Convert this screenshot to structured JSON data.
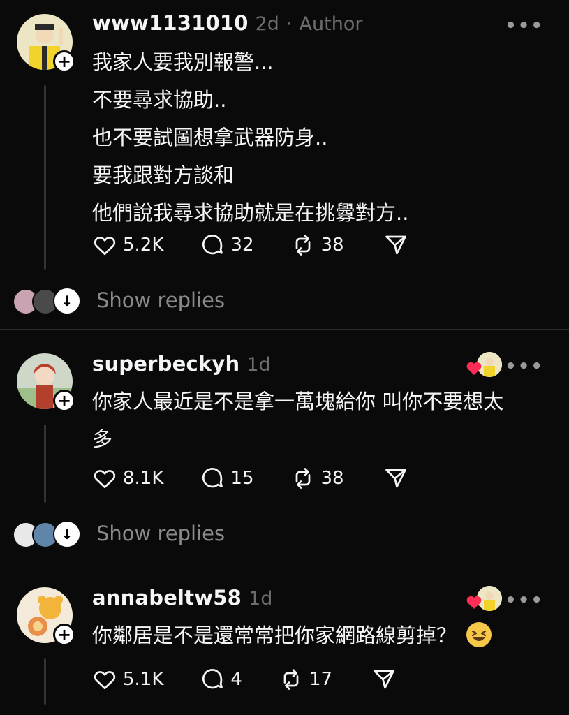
{
  "posts": [
    {
      "username": "www1131010",
      "time": "2d",
      "separator": "·",
      "author_tag": "Author",
      "more": "•••",
      "lines": [
        "我家人要我別報警...",
        "不要尋求協助..",
        "也不要試圖想拿武器防身..",
        "要我跟對方談和",
        "他們說我尋求協助就是在挑釁對方.."
      ],
      "likes": "5.2K",
      "replies": "32",
      "reposts": "38",
      "show_replies": "Show replies"
    },
    {
      "username": "superbeckyh",
      "time": "1d",
      "more": "•••",
      "lines": [
        "你家人最近是不是拿一萬塊給你 叫你不要想太",
        "多"
      ],
      "likes": "8.1K",
      "replies": "15",
      "reposts": "38",
      "show_replies": "Show replies"
    },
    {
      "username": "annabeltw58",
      "time": "1d",
      "more": "•••",
      "lines": [
        "你鄰居是不是還常常把你家網路線剪掉？"
      ],
      "likes": "5.1K",
      "replies": "4",
      "reposts": "17"
    }
  ],
  "icons": {
    "follow": "plus-icon",
    "like": "heart-icon",
    "reply": "comment-icon",
    "repost": "repost-icon",
    "share": "send-icon",
    "expand": "arrow-down-icon",
    "emoji": "grinning-squinting-face-emoji"
  },
  "colors": {
    "background": "#0a0a0a",
    "text": "#f3f5f7",
    "muted": "#6d6d6d",
    "heart": "#ff2d55"
  },
  "follow_symbol": "+",
  "expand_symbol": "↓"
}
